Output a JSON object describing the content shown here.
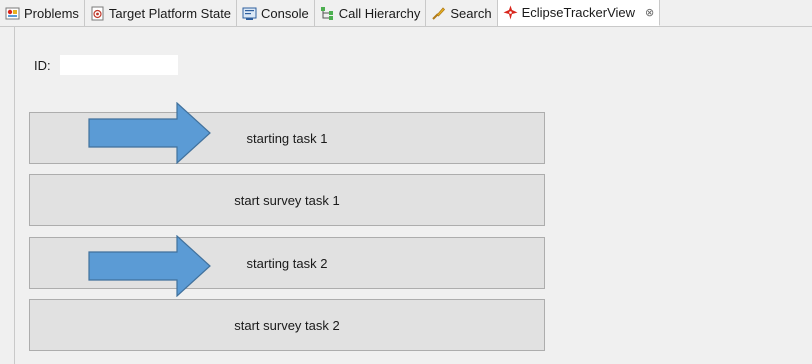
{
  "tabs": [
    {
      "label": "Problems",
      "icon": "problems-icon"
    },
    {
      "label": "Target Platform State",
      "icon": "target-platform-icon"
    },
    {
      "label": "Console",
      "icon": "console-icon"
    },
    {
      "label": "Call Hierarchy",
      "icon": "call-hierarchy-icon"
    },
    {
      "label": "Search",
      "icon": "search-icon"
    },
    {
      "label": "EclipseTrackerView",
      "icon": "tracker-icon",
      "active": true,
      "close": "⊗"
    }
  ],
  "form": {
    "id_label": "ID:",
    "id_value": ""
  },
  "tasks": [
    {
      "label": "starting task 1",
      "arrow": true
    },
    {
      "label": "start survey task 1",
      "arrow": false
    },
    {
      "label": "starting task 2",
      "arrow": true
    },
    {
      "label": "start survey task 2",
      "arrow": false
    }
  ],
  "colors": {
    "arrow_fill": "#5b9bd5",
    "arrow_stroke": "#41719c",
    "button_bg": "#e1e1e1",
    "tracker_icon": "#d9261c"
  }
}
